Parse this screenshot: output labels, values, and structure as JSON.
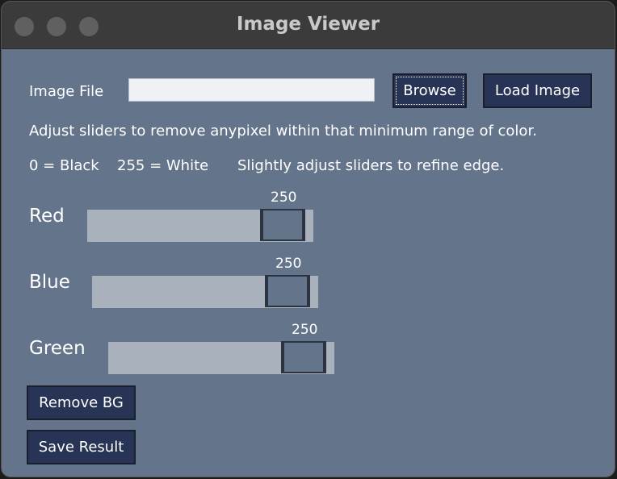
{
  "window": {
    "title": "Image Viewer"
  },
  "file_row": {
    "label": "Image File",
    "input_value": "",
    "browse_label": "Browse",
    "load_label": "Load Image"
  },
  "instructions": {
    "line1": "Adjust sliders to remove anypixel within that minimum range of color.",
    "black": "0 = Black",
    "white": "255 = White",
    "refine": "Slightly adjust sliders to refine edge."
  },
  "sliders": [
    {
      "label": "Red",
      "value": "250",
      "level": 250,
      "max": 255
    },
    {
      "label": "Blue",
      "value": "250",
      "level": 250,
      "max": 255
    },
    {
      "label": "Green",
      "value": "250",
      "level": 250,
      "max": 255
    }
  ],
  "actions": {
    "remove_bg": "Remove BG",
    "save_result": "Save Result"
  },
  "colors": {
    "background": "#64748b",
    "button": "#283456",
    "titlebar": "#3b3b3b"
  }
}
